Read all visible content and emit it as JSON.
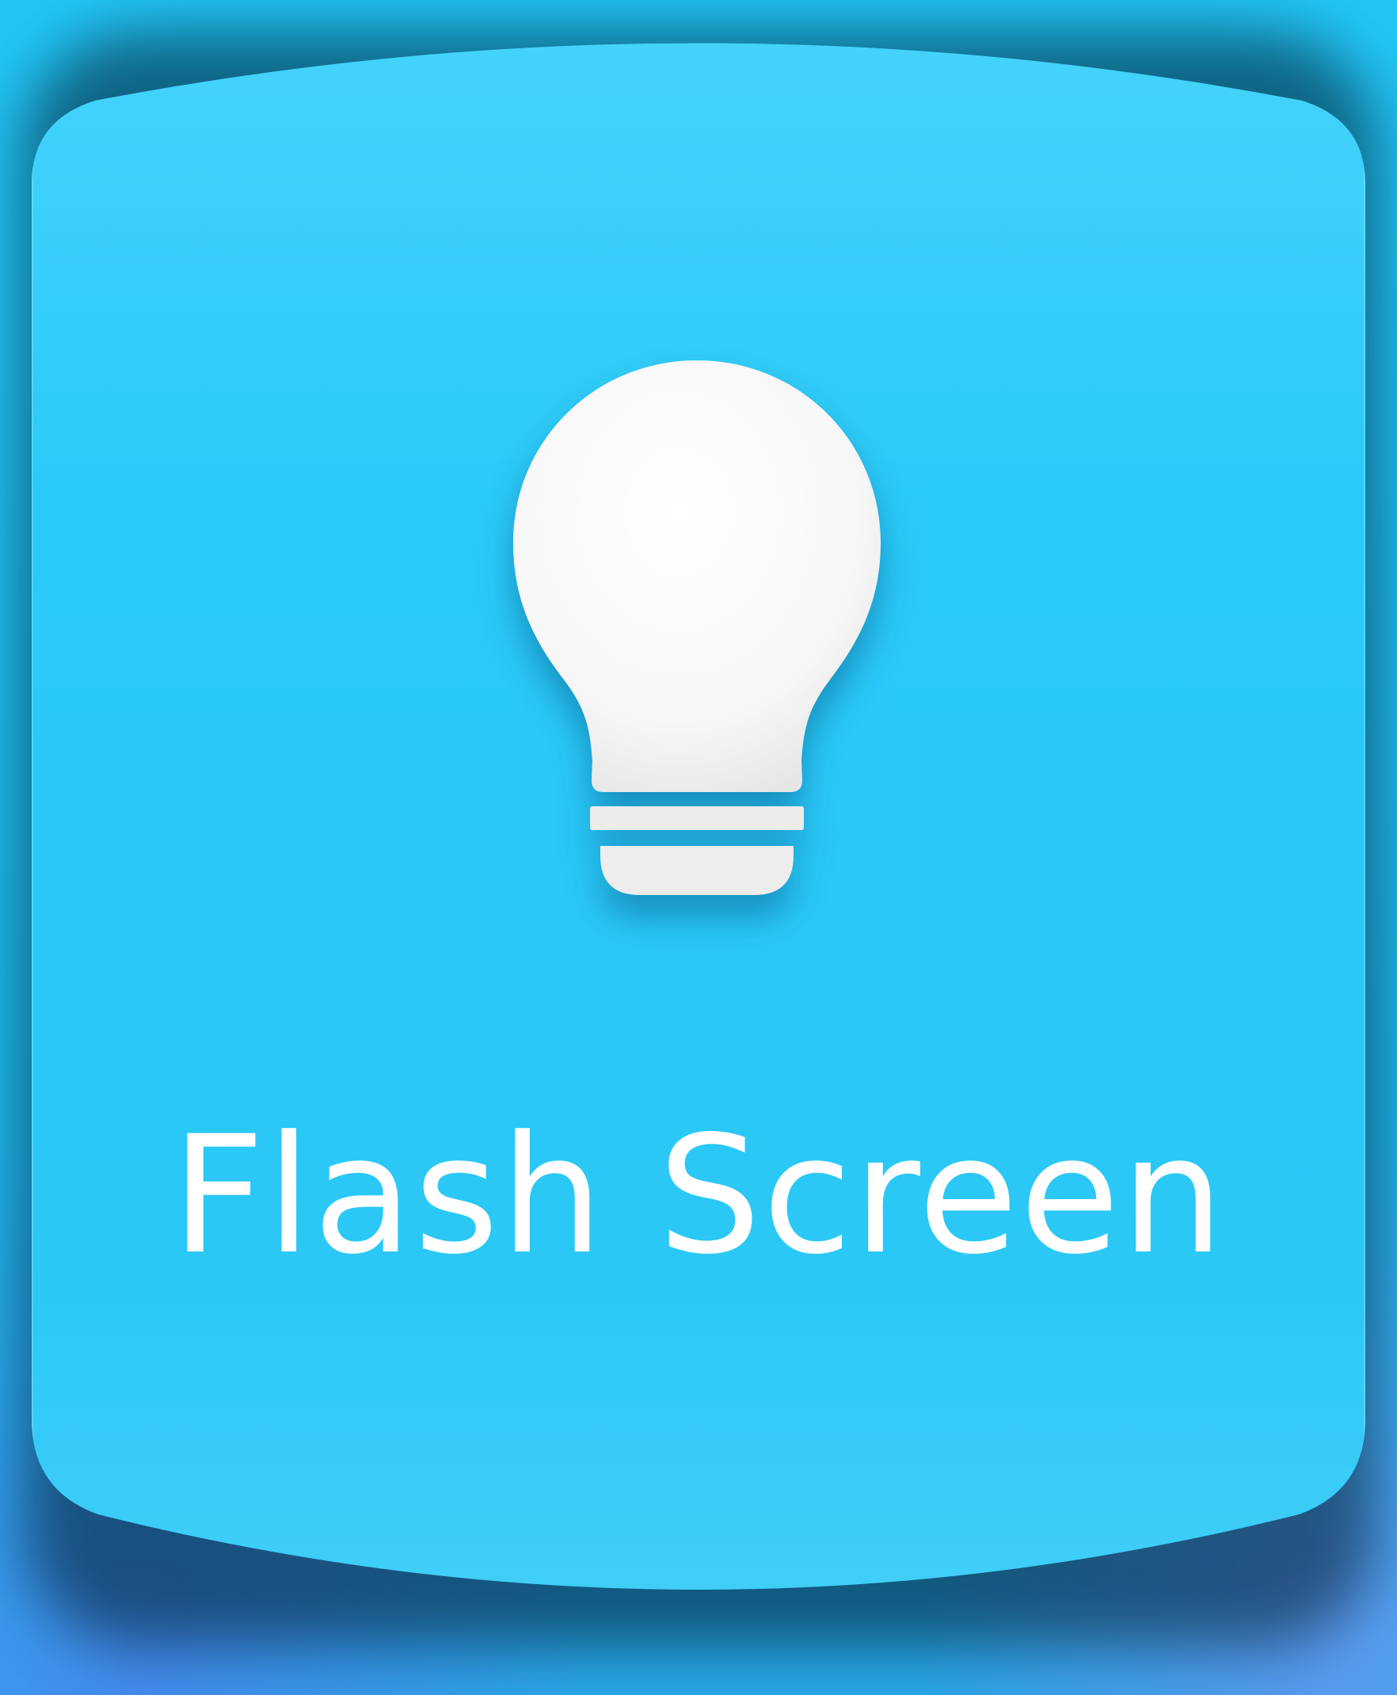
{
  "tile": {
    "label": "Flash Screen",
    "icon": "lightbulb-icon",
    "background_color": "#29c8f7",
    "icon_color": "#ffffff",
    "text_color": "#ffffff"
  }
}
